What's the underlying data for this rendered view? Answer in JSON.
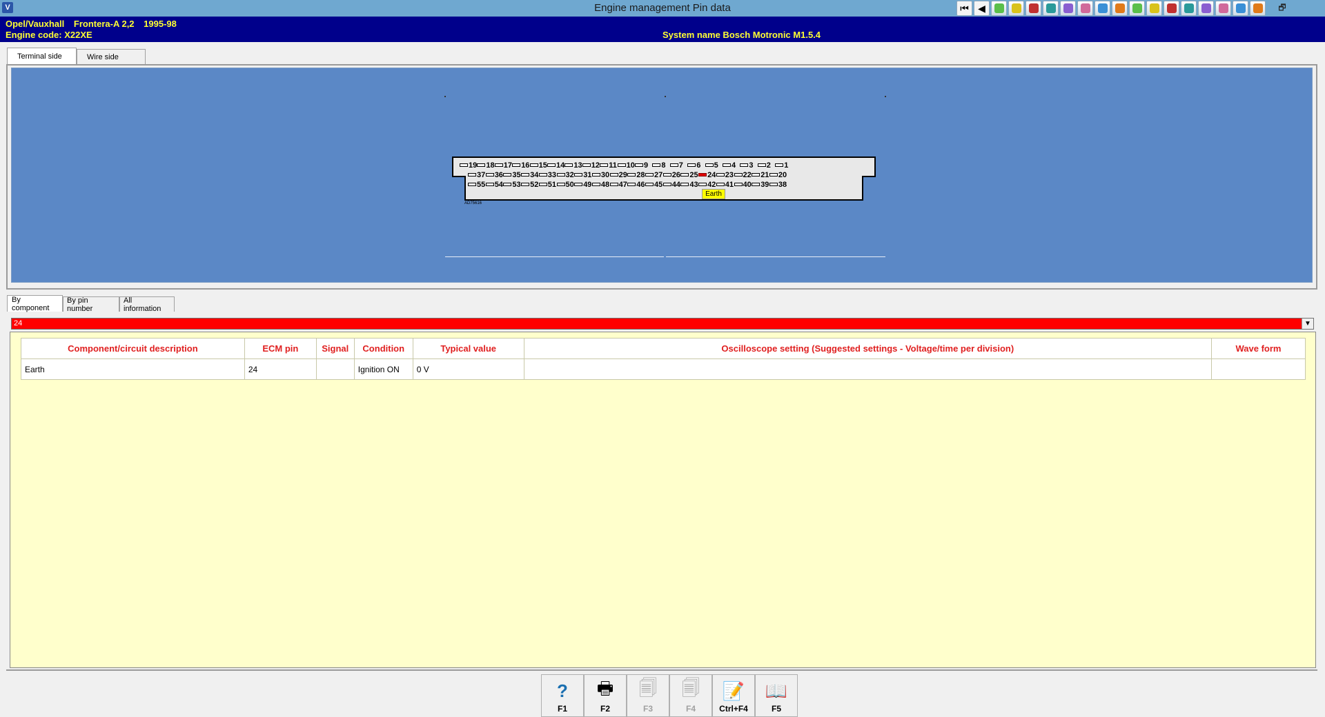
{
  "window": {
    "title": "Engine management Pin data",
    "app_icon": "app-logo-icon",
    "restore_glyph": "🗗"
  },
  "toolbar": {
    "icons": [
      "first-page-icon",
      "previous-page-icon",
      "tool-1-icon",
      "tool-2-icon",
      "tool-3-icon",
      "tool-4-icon",
      "tool-5-icon",
      "tool-6-icon",
      "tool-7-icon",
      "tool-8-icon",
      "tool-9-icon",
      "tool-10-icon",
      "tool-11-icon",
      "tool-12-icon",
      "tool-13-icon",
      "tool-14-icon",
      "tool-15-icon",
      "tool-16-icon"
    ],
    "nav_glyphs": [
      "⏮",
      "◀"
    ]
  },
  "vehicle": {
    "make": "Opel/Vauxhall",
    "model": "Frontera-A 2,2",
    "years": "1995-98",
    "engine_code": "Engine code: X22XE",
    "system_name": "System name Bosch Motronic M1.5.4"
  },
  "view_tabs": [
    {
      "label": "Terminal side",
      "active": true
    },
    {
      "label": "Wire side",
      "active": false
    }
  ],
  "connector": {
    "row1": [
      "19",
      "18",
      "17",
      "16",
      "15",
      "14",
      "13",
      "12",
      "11",
      "10",
      "9",
      "8",
      "7",
      "6",
      "5",
      "4",
      "3",
      "2",
      "1"
    ],
    "row2": [
      "37",
      "36",
      "35",
      "34",
      "33",
      "32",
      "31",
      "30",
      "29",
      "28",
      "27",
      "26",
      "25",
      "24",
      "23",
      "22",
      "21",
      "20"
    ],
    "row3": [
      "55",
      "54",
      "53",
      "52",
      "51",
      "50",
      "49",
      "48",
      "47",
      "46",
      "45",
      "44",
      "43",
      "42",
      "41",
      "40",
      "39",
      "38"
    ],
    "highlighted_pin": "24",
    "highlight_color": "#e00000",
    "pin_label": "Earth",
    "reference_code": "AD75616"
  },
  "info_tabs": [
    {
      "label": "By component",
      "active": true
    },
    {
      "label": "By pin number",
      "active": false
    },
    {
      "label": "All information",
      "active": false
    }
  ],
  "selector": {
    "value": "24",
    "color": "#ff0000",
    "dropdown_glyph": "▼"
  },
  "table": {
    "headers": [
      "Component/circuit description",
      "ECM pin",
      "Signal",
      "Condition",
      "Typical value",
      "Oscilloscope setting (Suggested settings - Voltage/time per division)",
      "Wave form"
    ],
    "rows": [
      [
        "Earth",
        "24",
        "",
        "Ignition ON",
        "0 V",
        "",
        ""
      ]
    ]
  },
  "function_keys": [
    {
      "label": "F1",
      "icon": "help-icon",
      "glyph": "?",
      "enabled": true
    },
    {
      "label": "F2",
      "icon": "printer-icon",
      "glyph": "🖶",
      "enabled": true
    },
    {
      "label": "F3",
      "icon": "print-preview-icon",
      "glyph": "🗐",
      "enabled": false
    },
    {
      "label": "F4",
      "icon": "print-setup-icon",
      "glyph": "🗐",
      "enabled": false
    },
    {
      "label": "Ctrl+F4",
      "icon": "notes-edit-icon",
      "glyph": "📝",
      "enabled": true
    },
    {
      "label": "F5",
      "icon": "manual-book-icon",
      "glyph": "📖",
      "enabled": true
    }
  ]
}
